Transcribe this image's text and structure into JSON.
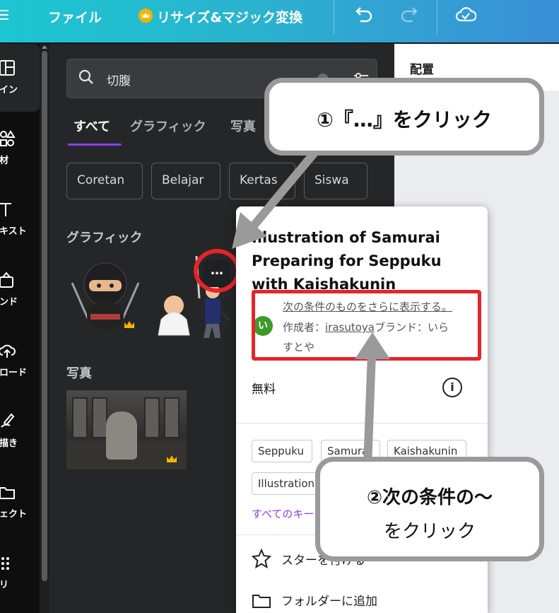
{
  "topbar": {
    "file_label": "ファイル",
    "resize_label": "リサイズ&マジック変換"
  },
  "rail": {
    "items": [
      {
        "label": "デザイン",
        "icon": "layout-icon"
      },
      {
        "label": "素材",
        "icon": "elements-icon"
      },
      {
        "label": "テキスト",
        "icon": "text-icon"
      },
      {
        "label": "ブランド",
        "icon": "brand-icon"
      },
      {
        "label": "アップロード",
        "icon": "upload-icon"
      },
      {
        "label": "描き",
        "icon": "draw-icon"
      },
      {
        "label": "プロジェクト",
        "icon": "folder-icon"
      },
      {
        "label": "アプリ",
        "icon": "apps-icon"
      }
    ],
    "visible": [
      "デザイン",
      "素材",
      "テキスト",
      "ブランド",
      "アップロード",
      "描き",
      "プロジェクト",
      "アプリ"
    ]
  },
  "rail_cropped": [
    "ザイン",
    "素材",
    "テキスト",
    "ランド",
    "プロード",
    "絵描き",
    "ジェクト",
    "プリ"
  ],
  "search": {
    "value": "切腹"
  },
  "tabs": [
    "すべて",
    "グラフィック",
    "写真"
  ],
  "chips": [
    "Coretan",
    "Belajar",
    "Kertas",
    "Siswa"
  ],
  "sections": {
    "graphics": "グラフィック",
    "photos": "写真"
  },
  "more_button": "…",
  "right_panel": {
    "title": "配置"
  },
  "popup": {
    "title": "Illustration of Samurai Preparing for Seppuku with Kaishakunin",
    "author_avatar": "い",
    "more_link": "次の条件のものをさらに表示する。",
    "author_prefix": "作成者：",
    "author_name": "irasutoya",
    "brand_label": "ブランド：いら",
    "brand_label_cont": "すとや",
    "price": "無料",
    "keywords": [
      "Seppuku",
      "Samurai",
      "Kaishakunin",
      "Illustration"
    ],
    "all_keywords_link": "すべてのキーワード",
    "star_label": "スターを付ける",
    "folder_label": "フォルダーに追加"
  },
  "callouts": {
    "first": "①『…』をクリック",
    "second_line1": "②次の条件の～",
    "second_line2": "をクリック"
  },
  "colors": {
    "accent": "#8b3dff",
    "annotation_red": "#e5242b",
    "callout_border": "#9a9a9a"
  }
}
